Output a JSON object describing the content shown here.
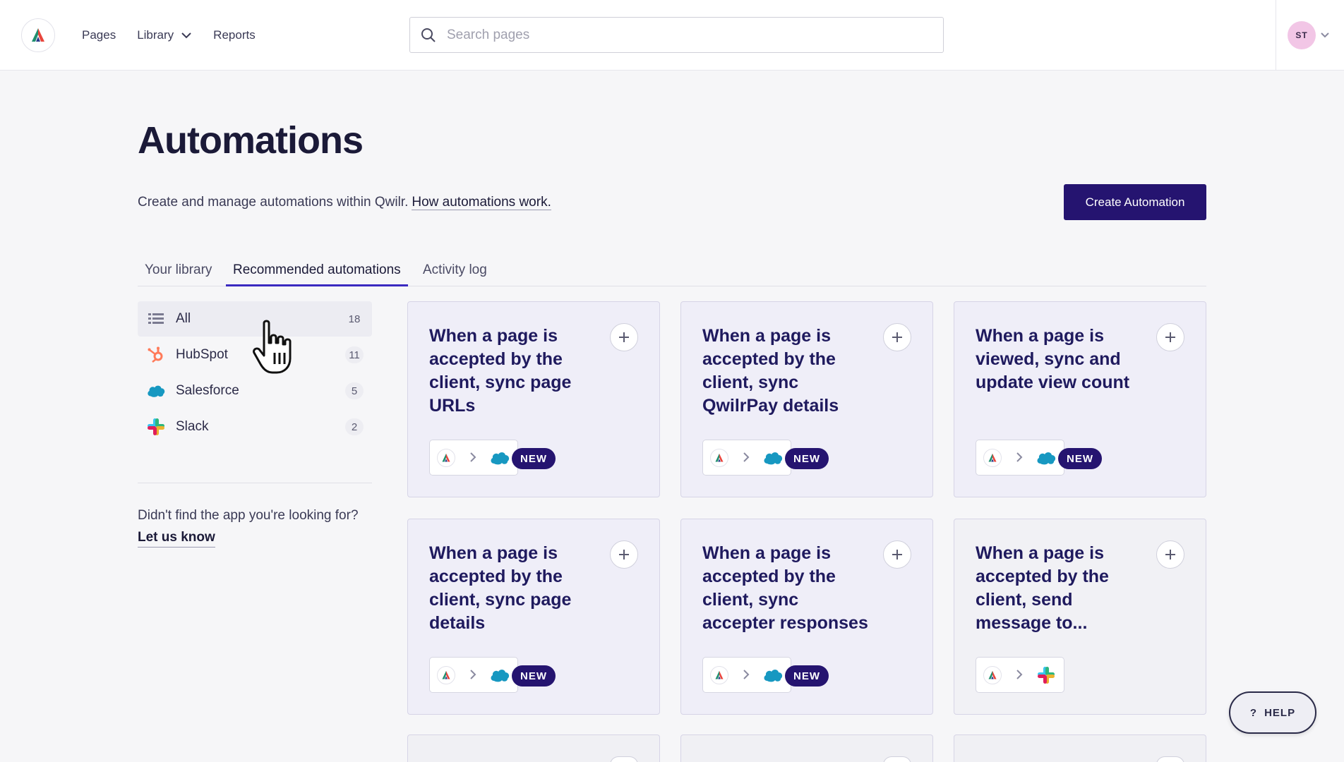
{
  "nav": {
    "items": [
      {
        "label": "Pages"
      },
      {
        "label": "Library"
      },
      {
        "label": "Reports"
      }
    ]
  },
  "search": {
    "placeholder": "Search pages",
    "value": ""
  },
  "user": {
    "initials": "ST"
  },
  "header": {
    "title": "Automations",
    "description": "Create and manage automations within Qwilr.",
    "description_link": "How automations work.",
    "create_button": "Create Automation"
  },
  "tabs": [
    {
      "label": "Your library",
      "active": false
    },
    {
      "label": "Recommended automations",
      "active": true
    },
    {
      "label": "Activity log",
      "active": false
    }
  ],
  "filters": [
    {
      "label": "All",
      "count": "18",
      "icon": "list-icon",
      "active": true
    },
    {
      "label": "HubSpot",
      "count": "11",
      "icon": "hubspot-icon",
      "active": false
    },
    {
      "label": "Salesforce",
      "count": "5",
      "icon": "salesforce-icon",
      "active": false
    },
    {
      "label": "Slack",
      "count": "2",
      "icon": "slack-icon",
      "active": false
    }
  ],
  "sidebar": {
    "help_text": "Didn't find the app you're looking for?",
    "help_link": "Let us know"
  },
  "cards": [
    {
      "title": "When a page is accepted by the client, sync page URLs",
      "target": "salesforce-icon",
      "badge": "NEW"
    },
    {
      "title": "When a page is accepted by the client, sync QwilrPay details",
      "target": "salesforce-icon",
      "badge": "NEW"
    },
    {
      "title": "When a page is viewed, sync and update view count",
      "target": "salesforce-icon",
      "badge": "NEW"
    },
    {
      "title": "When a page is accepted by the client, sync page details",
      "target": "salesforce-icon",
      "badge": "NEW"
    },
    {
      "title": "When a page is accepted by the client, sync accepter responses",
      "target": "salesforce-icon",
      "badge": "NEW"
    },
    {
      "title": "When a page is accepted by the client, send message to...",
      "target": "slack-icon",
      "badge": ""
    }
  ],
  "help_button": {
    "icon": "?",
    "label": "HELP"
  },
  "colors": {
    "primary": "#251470",
    "card_title": "#1f1a5e",
    "tab_accent": "#3a2ac0",
    "salesforce": "#1798c1"
  }
}
